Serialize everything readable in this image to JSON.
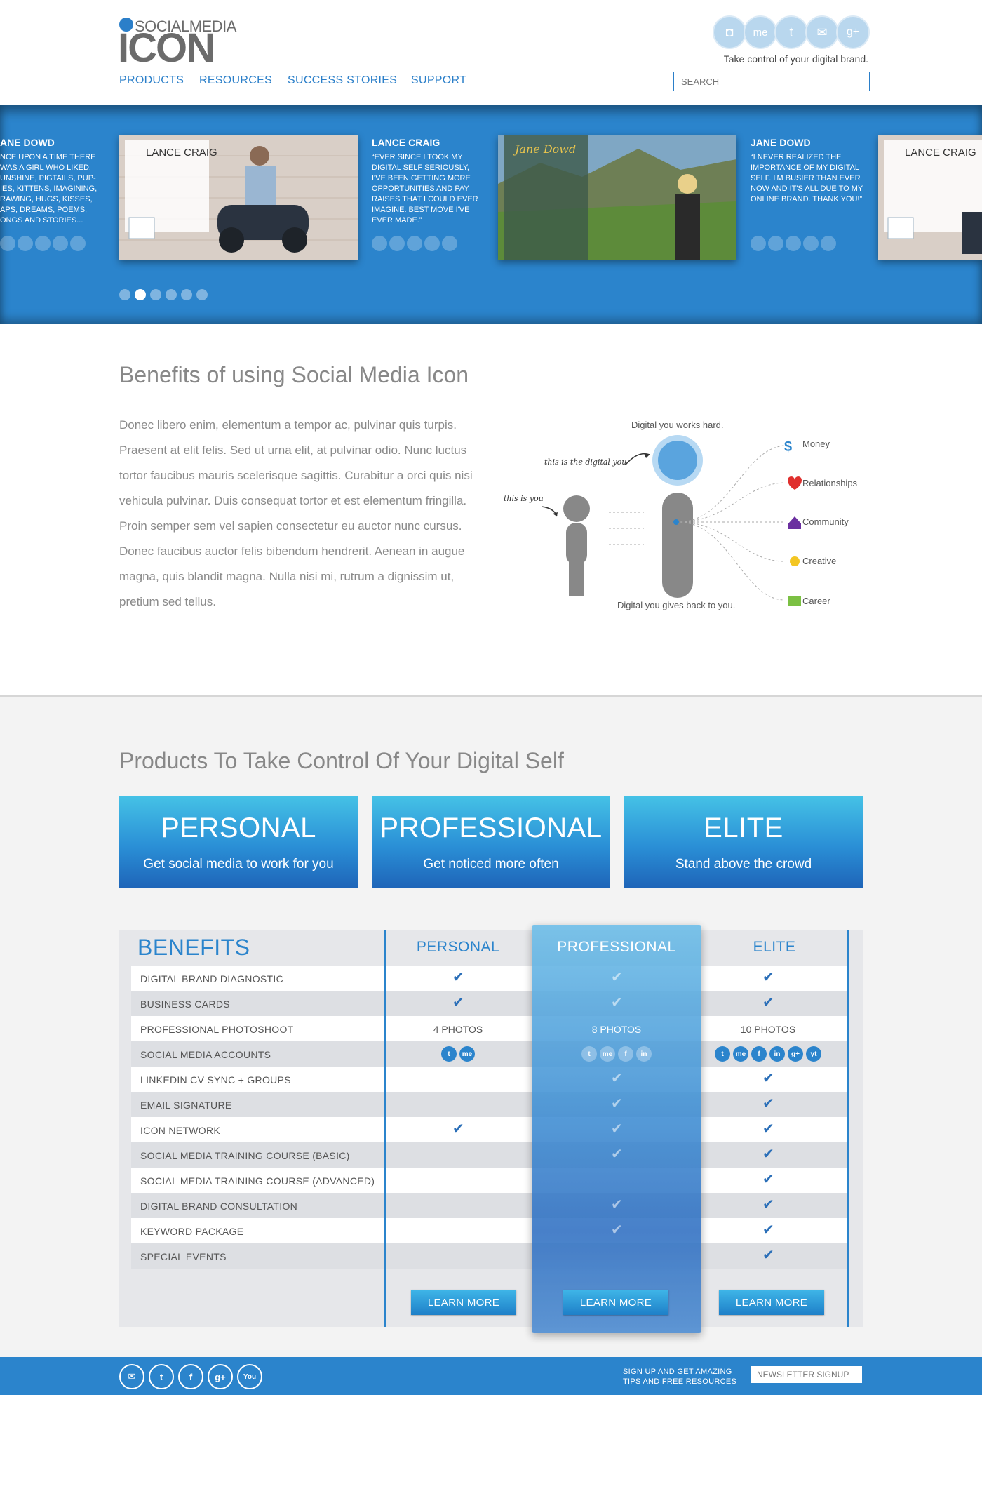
{
  "brand": {
    "small": "SOCIALMEDIA",
    "big": "ICON"
  },
  "nav": [
    "PRODUCTS",
    "RESOURCES",
    "SUCCESS STORIES",
    "SUPPORT"
  ],
  "header": {
    "social_icons": [
      "camera-icon",
      "me-icon",
      "twitter-icon",
      "email-icon",
      "google-plus-icon"
    ],
    "tagline": "Take control of your digital brand.",
    "search_placeholder": "SEARCH"
  },
  "slider": {
    "slides": [
      {
        "name": "ANE DOWD",
        "quote": "NCE UPON A TIME THERE WAS A GIRL WHO LIKED: UNSHINE, PIGTAILS, PUP-IES, KITTENS, IMAGINING, RAWING, HUGS, KISSES, APS, DREAMS, POEMS, ONGS AND STORIES..."
      },
      {
        "name": "LANCE CRAIG",
        "quote": "“EVER SINCE I TOOK MY DIGITAL SELF SERIOUSLY, I'VE BEEN GETTING MORE OPPORTUNITIES AND PAY RAISES THAT I COULD EVER IMAGINE. BEST MOVE I'VE EVER MADE.”"
      },
      {
        "name": "JANE DOWD",
        "quote": "“I NEVER REALIZED THE IMPORTANCE OF MY DIGITAL SELF. I'M BUSIER THAN EVER NOW AND IT'S ALL DUE TO MY ONLINE BRAND. THANK YOU!”"
      }
    ],
    "thumb_titles": [
      "LANCE CRAIG",
      "Jane Dowd",
      "LANCE CRAIG"
    ],
    "dots": 6,
    "active_dot": 2
  },
  "benefits": {
    "title": "Benefits of using Social Media Icon",
    "body": "Donec libero enim, elementum a tempor ac, pulvinar quis turpis. Praesent at elit felis. Sed ut urna elit, at pulvinar odio. Nunc luctus tortor faucibus mauris scelerisque sagittis. Curabitur a orci quis nisi vehicula pulvinar. Duis consequat tortor et est elementum fringilla. Proin semper sem vel sapien consectetur eu auctor nunc cursus. Donec faucibus auctor felis bibendum hendrerit. Aenean in augue magna, quis blandit magna. Nulla nisi mi, rutrum a dignissim ut, pretium sed tellus.",
    "diagram": {
      "top_label": "Digital you works hard.",
      "bottom_label": "Digital you gives back to you.",
      "script_digital": "this is the digital you",
      "script_you": "this is you",
      "outcomes": [
        "Money",
        "Relationships",
        "Community",
        "Creative",
        "Career"
      ]
    }
  },
  "products": {
    "title": "Products To Take Control Of Your Digital Self",
    "cards": [
      {
        "title": "PERSONAL",
        "subtitle": "Get social media to work for you"
      },
      {
        "title": "PROFESSIONAL",
        "subtitle": "Get noticed more often"
      },
      {
        "title": "ELITE",
        "subtitle": "Stand above the crowd"
      }
    ]
  },
  "table": {
    "header": "BENEFITS",
    "columns": [
      "PERSONAL",
      "PROFESSIONAL",
      "ELITE"
    ],
    "rows": [
      {
        "label": "DIGITAL BRAND DIAGNOSTIC",
        "personal": "check",
        "professional": "check",
        "elite": "check"
      },
      {
        "label": "BUSINESS CARDS",
        "personal": "check",
        "professional": "check",
        "elite": "check"
      },
      {
        "label": "PROFESSIONAL PHOTOSHOOT",
        "personal": "4 PHOTOS",
        "professional": "8 PHOTOS",
        "elite": "10 PHOTOS"
      },
      {
        "label": "SOCIAL MEDIA ACCOUNTS",
        "personal": "social",
        "professional": "social",
        "elite": "social"
      },
      {
        "label": "LINKEDIN CV SYNC + GROUPS",
        "personal": "",
        "professional": "check",
        "elite": "check"
      },
      {
        "label": "EMAIL SIGNATURE",
        "personal": "",
        "professional": "check",
        "elite": "check"
      },
      {
        "label": "ICON NETWORK",
        "personal": "check",
        "professional": "check",
        "elite": "check"
      },
      {
        "label": "SOCIAL MEDIA TRAINING COURSE (BASIC)",
        "personal": "",
        "professional": "check",
        "elite": "check"
      },
      {
        "label": "SOCIAL MEDIA TRAINING COURSE (ADVANCED)",
        "personal": "",
        "professional": "",
        "elite": "check"
      },
      {
        "label": "DIGITAL BRAND CONSULTATION",
        "personal": "",
        "professional": "check",
        "elite": "check"
      },
      {
        "label": "KEYWORD PACKAGE",
        "personal": "",
        "professional": "check",
        "elite": "check"
      },
      {
        "label": "SPECIAL EVENTS",
        "personal": "",
        "professional": "",
        "elite": "check"
      }
    ],
    "social_personal": [
      "t",
      "me"
    ],
    "social_professional": [
      "t",
      "me",
      "f",
      "in"
    ],
    "social_elite": [
      "t",
      "me",
      "f",
      "in",
      "g+",
      "yt"
    ],
    "learn_more": "LEARN MORE"
  },
  "footer": {
    "icons": [
      "email-icon",
      "twitter-icon",
      "facebook-icon",
      "google-plus-icon",
      "youtube-icon"
    ],
    "icon_glyphs": [
      "✉",
      "t",
      "f",
      "g+",
      "You"
    ],
    "signup_line1": "SIGN UP AND GET AMAZING",
    "signup_line2": "TIPS AND FREE RESOURCES",
    "newsletter_placeholder": "NEWSLETTER SIGNUP"
  },
  "colors": {
    "brand_blue": "#2b84cc",
    "text_gray": "#888888",
    "background_gray": "#f3f3f3"
  }
}
